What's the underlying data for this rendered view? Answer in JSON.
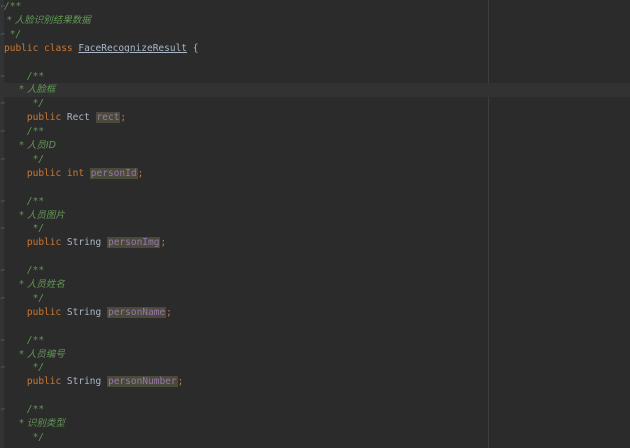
{
  "lines": [
    {
      "kind": "comment",
      "text": "/**",
      "fold": true
    },
    {
      "kind": "comment",
      "text": " * 人脸识别结果数据"
    },
    {
      "kind": "comment",
      "text": " */",
      "fold": true
    },
    {
      "kind": "class",
      "kw": "public class ",
      "name": "FaceRecognizeResult",
      "tail": " {"
    },
    {
      "kind": "blank"
    },
    {
      "kind": "comment",
      "text": "    /**",
      "fold": true
    },
    {
      "kind": "comment",
      "text": "     * 人脸框",
      "current": true
    },
    {
      "kind": "comment",
      "text": "     */",
      "fold": true
    },
    {
      "kind": "field",
      "kw": "    public ",
      "type": "Rect ",
      "name": "rect",
      "tail": ";"
    },
    {
      "kind": "comment",
      "text": "    /**",
      "fold": true
    },
    {
      "kind": "comment",
      "text": "     * 人员ID"
    },
    {
      "kind": "comment",
      "text": "     */",
      "fold": true
    },
    {
      "kind": "field",
      "kw": "    public int ",
      "type": "",
      "name": "personId",
      "tail": ";"
    },
    {
      "kind": "blank"
    },
    {
      "kind": "comment",
      "text": "    /**",
      "fold": true
    },
    {
      "kind": "comment",
      "text": "     * 人员图片"
    },
    {
      "kind": "comment",
      "text": "     */",
      "fold": true
    },
    {
      "kind": "field",
      "kw": "    public ",
      "type": "String ",
      "name": "personImg",
      "tail": ";"
    },
    {
      "kind": "blank"
    },
    {
      "kind": "comment",
      "text": "    /**",
      "fold": true
    },
    {
      "kind": "comment",
      "text": "     * 人员姓名"
    },
    {
      "kind": "comment",
      "text": "     */",
      "fold": true
    },
    {
      "kind": "field",
      "kw": "    public ",
      "type": "String ",
      "name": "personName",
      "tail": ";"
    },
    {
      "kind": "blank"
    },
    {
      "kind": "comment",
      "text": "    /**",
      "fold": true
    },
    {
      "kind": "comment",
      "text": "     * 人员编号"
    },
    {
      "kind": "comment",
      "text": "     */",
      "fold": true
    },
    {
      "kind": "field",
      "kw": "    public ",
      "type": "String ",
      "name": "personNumber",
      "tail": ";"
    },
    {
      "kind": "blank"
    },
    {
      "kind": "comment",
      "text": "    /**",
      "fold": true
    },
    {
      "kind": "comment",
      "text": "     * 识别类型"
    },
    {
      "kind": "comment",
      "text": "     */"
    }
  ],
  "colors": {
    "background": "#2b2b2b",
    "keyword": "#cc7832",
    "comment": "#629755",
    "field": "#9876aa",
    "text": "#a9b7c6"
  }
}
